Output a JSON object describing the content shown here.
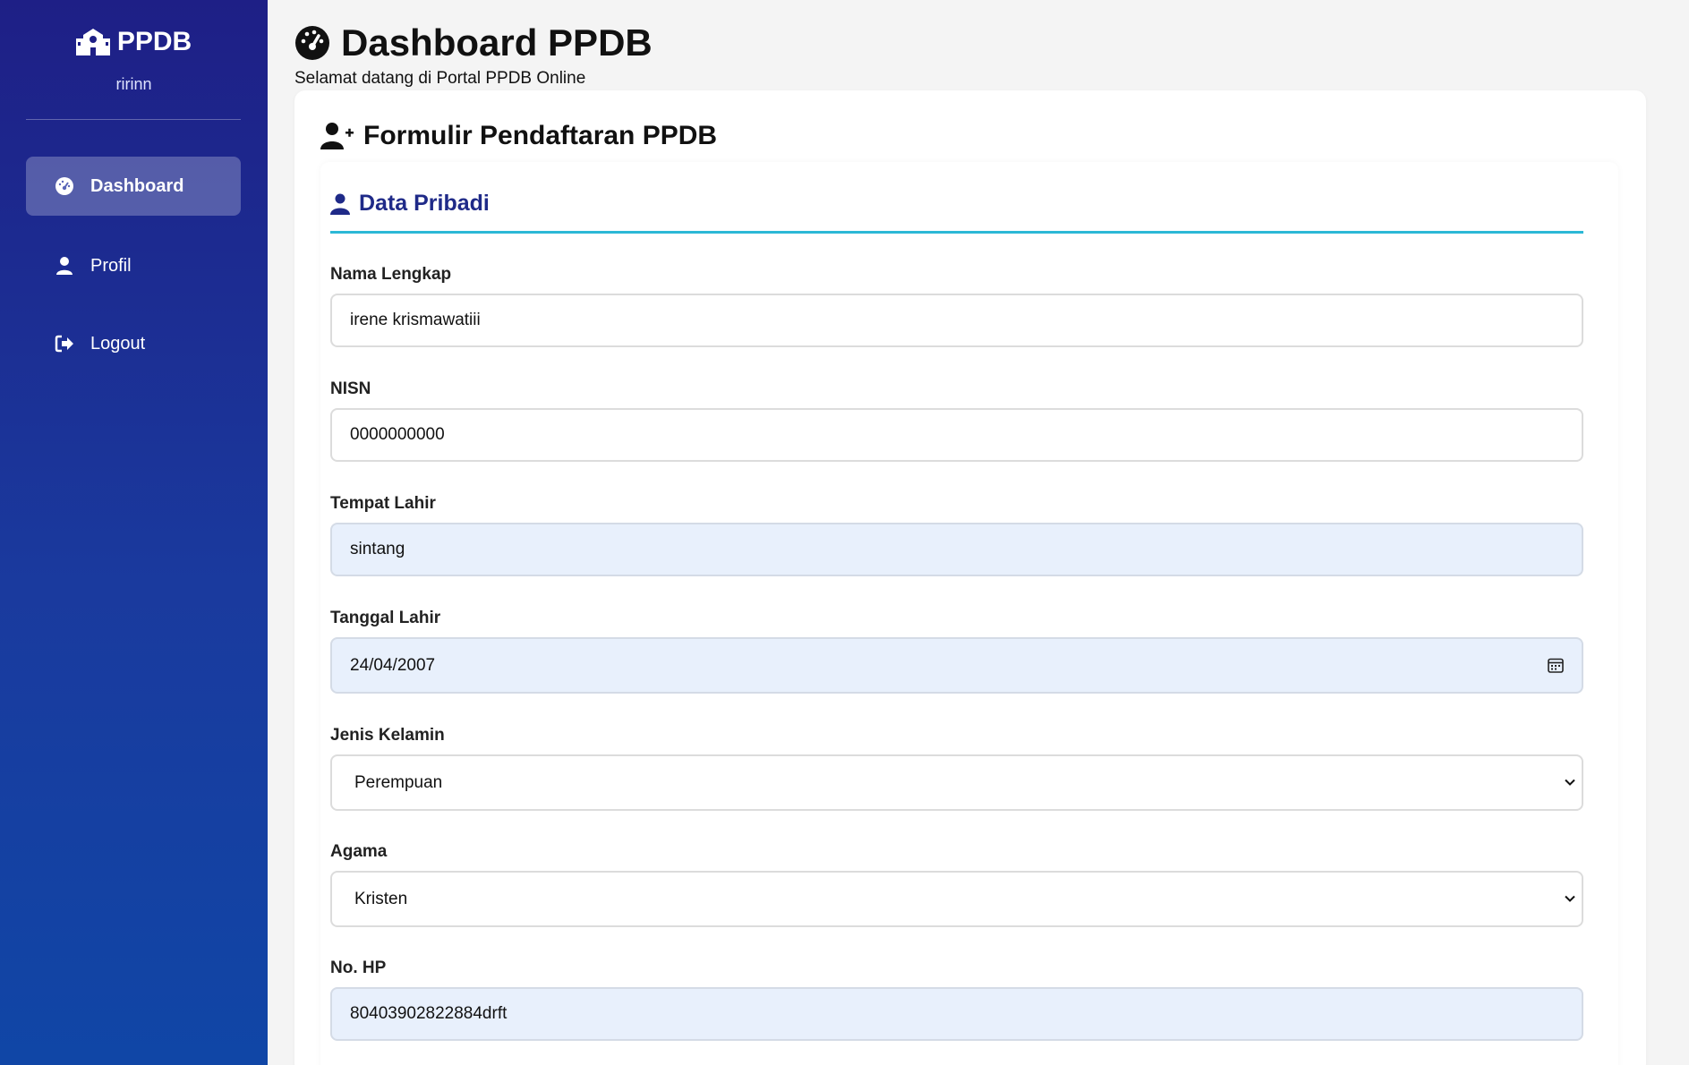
{
  "sidebar": {
    "brand": "PPDB",
    "username": "ririnn",
    "items": [
      {
        "label": "Dashboard",
        "icon": "gauge-icon",
        "active": true
      },
      {
        "label": "Profil",
        "icon": "user-icon",
        "active": false
      },
      {
        "label": "Logout",
        "icon": "logout-icon",
        "active": false
      }
    ]
  },
  "header": {
    "title": "Dashboard PPDB",
    "subtitle": "Selamat datang di Portal PPDB Online"
  },
  "form": {
    "title": "Formulir Pendaftaran PPDB",
    "section_title": "Data Pribadi",
    "fields": [
      {
        "label": "Nama Lengkap",
        "value": "irene krismawatiii",
        "type": "text"
      },
      {
        "label": "NISN",
        "value": "0000000000",
        "type": "text"
      },
      {
        "label": "Tempat Lahir",
        "value": "sintang",
        "type": "text"
      },
      {
        "label": "Tanggal Lahir",
        "value": "24/04/2007",
        "type": "date"
      },
      {
        "label": "Jenis Kelamin",
        "value": "Perempuan",
        "type": "select"
      },
      {
        "label": "Agama",
        "value": "Kristen",
        "type": "select"
      },
      {
        "label": "No. HP",
        "value": "80403902822884drft",
        "type": "text"
      }
    ]
  },
  "colors": {
    "sidebar_top": "#1e1f86",
    "sidebar_bottom": "#1046a6",
    "section_title": "#1f2a88",
    "section_line": "#2bb8d6",
    "autofill_bg": "#e8f0fc"
  }
}
